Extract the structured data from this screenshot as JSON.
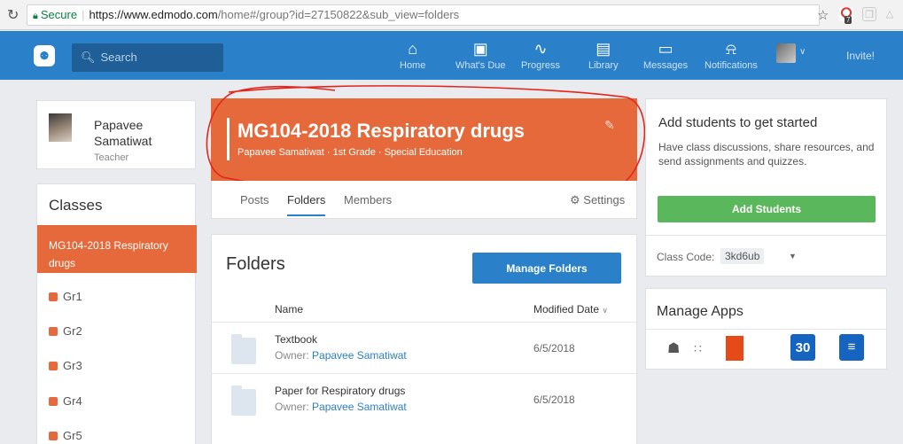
{
  "browser": {
    "secure_label": "Secure",
    "url_host": "https://www.edmodo.com",
    "url_path": "/home#/group?id=27150822&sub_view=folders",
    "ext_badge": "7"
  },
  "nav": {
    "search_placeholder": "Search",
    "items": [
      {
        "label": "Home",
        "icon": "home-icon"
      },
      {
        "label": "What's Due",
        "icon": "calendar-icon"
      },
      {
        "label": "Progress",
        "icon": "progress-icon"
      },
      {
        "label": "Library",
        "icon": "library-icon"
      },
      {
        "label": "Messages",
        "icon": "messages-icon"
      },
      {
        "label": "Notifications",
        "icon": "bell-icon"
      }
    ],
    "invite": "Invite!"
  },
  "profile": {
    "name": "Papavee Samatiwat",
    "role": "Teacher"
  },
  "classes": {
    "heading": "Classes",
    "active": "MG104-2018 Respiratory drugs",
    "groups": [
      "Gr1",
      "Gr2",
      "Gr3",
      "Gr4",
      "Gr5"
    ]
  },
  "group": {
    "title": "MG104-2018 Respiratory drugs",
    "subtitle": "Papavee Samatiwat · 1st Grade · Special Education",
    "tabs": [
      "Posts",
      "Folders",
      "Members"
    ],
    "settings": "Settings"
  },
  "folders": {
    "heading": "Folders",
    "manage_label": "Manage Folders",
    "col_name": "Name",
    "col_date": "Modified Date",
    "owner_prefix": "Owner:",
    "rows": [
      {
        "name": "Textbook",
        "owner": "Papavee Samatiwat",
        "date": "6/5/2018"
      },
      {
        "name": "Paper for Respiratory drugs",
        "owner": "Papavee Samatiwat",
        "date": "6/5/2018"
      }
    ]
  },
  "students": {
    "heading": "Add students to get started",
    "text": "Have class discussions, share resources, and send assignments and quizzes.",
    "button": "Add Students",
    "code_label": "Class Code:",
    "code_value": "3kd6ub"
  },
  "apps": {
    "heading": "Manage Apps",
    "calendar_number": "30"
  },
  "colors": {
    "brand_blue": "#2a80c9",
    "accent_orange": "#e6693b",
    "add_green": "#5bb75b"
  }
}
